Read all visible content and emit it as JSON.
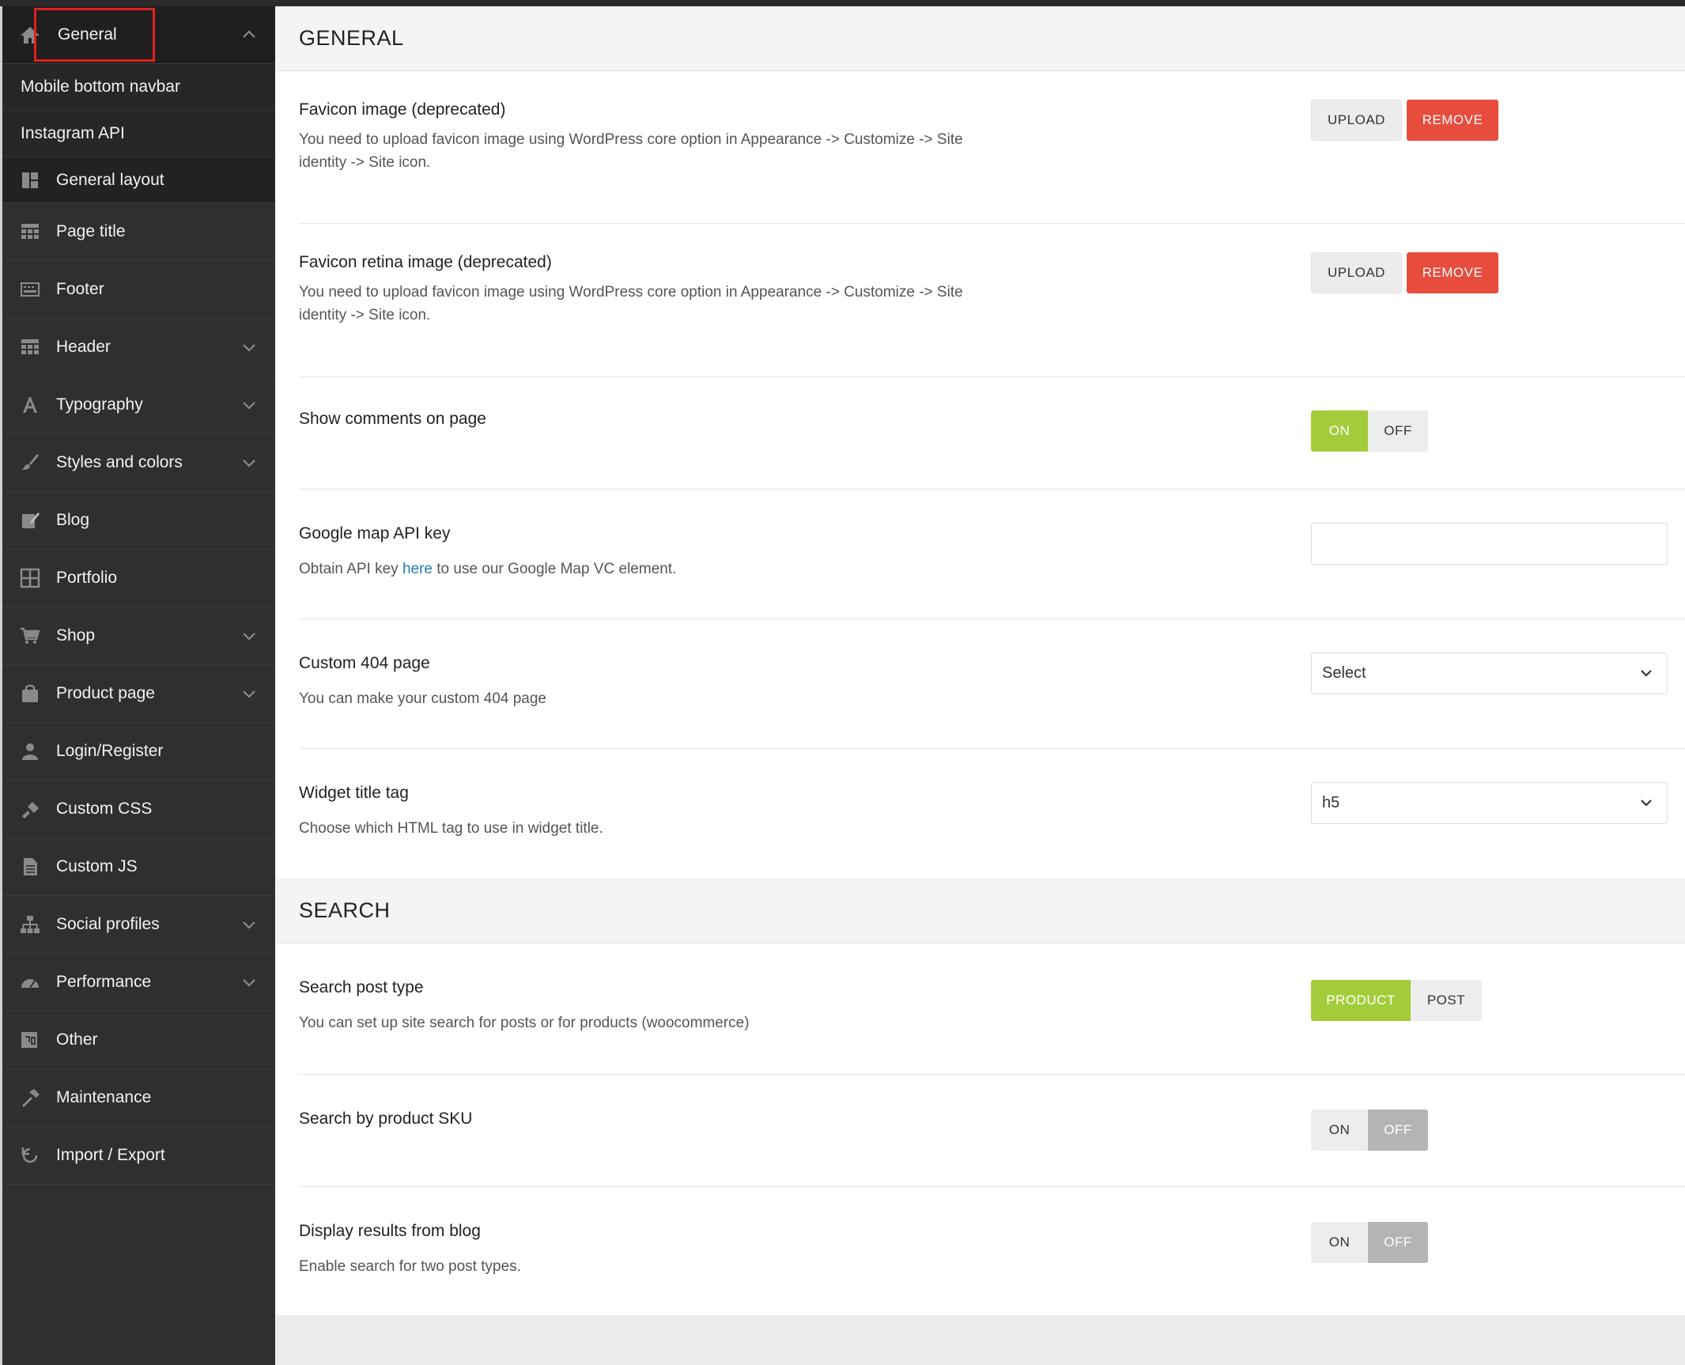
{
  "sidebar": {
    "general": "General",
    "sub_items": [
      "Mobile bottom navbar",
      "Instagram API"
    ],
    "items": [
      {
        "label": "General layout",
        "icon": "layout-icon",
        "chevron": false
      },
      {
        "label": "Page title",
        "icon": "page-title-icon",
        "chevron": false
      },
      {
        "label": "Footer",
        "icon": "footer-icon",
        "chevron": false
      },
      {
        "label": "Header",
        "icon": "header-icon",
        "chevron": true
      },
      {
        "label": "Typography",
        "icon": "typography-icon",
        "chevron": true
      },
      {
        "label": "Styles and colors",
        "icon": "brush-icon",
        "chevron": true
      },
      {
        "label": "Blog",
        "icon": "edit-icon",
        "chevron": false
      },
      {
        "label": "Portfolio",
        "icon": "grid-icon",
        "chevron": false
      },
      {
        "label": "Shop",
        "icon": "cart-icon",
        "chevron": true
      },
      {
        "label": "Product page",
        "icon": "bag-icon",
        "chevron": true
      },
      {
        "label": "Login/Register",
        "icon": "user-icon",
        "chevron": false
      },
      {
        "label": "Custom CSS",
        "icon": "css-icon",
        "chevron": false
      },
      {
        "label": "Custom JS",
        "icon": "document-icon",
        "chevron": false
      },
      {
        "label": "Social profiles",
        "icon": "sitemap-icon",
        "chevron": true
      },
      {
        "label": "Performance",
        "icon": "dashboard-icon",
        "chevron": true
      },
      {
        "label": "Other",
        "icon": "other-icon",
        "chevron": false
      },
      {
        "label": "Maintenance",
        "icon": "hammer-icon",
        "chevron": false
      },
      {
        "label": "Import / Export",
        "icon": "refresh-icon",
        "chevron": false
      }
    ]
  },
  "general_section": {
    "heading": "GENERAL",
    "favicon": {
      "title": "Favicon image (deprecated)",
      "desc": "You need to upload favicon image using WordPress core option in Appearance -> Customize -> Site identity -> Site icon.",
      "upload": "UPLOAD",
      "remove": "REMOVE"
    },
    "favicon_retina": {
      "title": "Favicon retina image (deprecated)",
      "desc": "You need to upload favicon image using WordPress core option in Appearance -> Customize -> Site identity -> Site icon.",
      "upload": "UPLOAD",
      "remove": "REMOVE"
    },
    "comments": {
      "title": "Show comments on page",
      "on": "ON",
      "off": "OFF"
    },
    "map_key": {
      "title": "Google map API key",
      "desc_before": "Obtain API key",
      "link": "here",
      "desc_after": "to use our Google Map VC element.",
      "value": ""
    },
    "custom_404": {
      "title": "Custom 404 page",
      "desc": "You can make your custom 404 page",
      "selected": "Select"
    },
    "widget_tag": {
      "title": "Widget title tag",
      "desc": "Choose which HTML tag to use in widget title.",
      "selected": "h5"
    }
  },
  "search_section": {
    "heading": "SEARCH",
    "post_type": {
      "title": "Search post type",
      "desc": "You can set up site search for posts or for products (woocommerce)",
      "product": "PRODUCT",
      "post": "POST"
    },
    "sku": {
      "title": "Search by product SKU",
      "on": "ON",
      "off": "OFF"
    },
    "blog_results": {
      "title": "Display results from blog",
      "desc": "Enable search for two post types.",
      "on": "ON",
      "off": "OFF"
    }
  },
  "colors": {
    "sidebar_bg": "#2f2f2f",
    "toggle_active": "#a4cc3a",
    "remove_red": "#e74c3c",
    "link_blue": "#1e7db8",
    "highlight_red": "#e0201f"
  }
}
